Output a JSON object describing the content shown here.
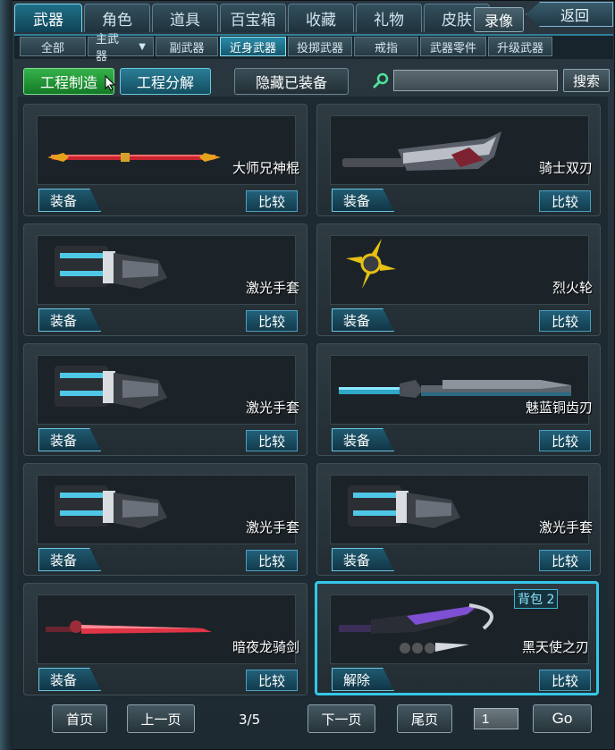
{
  "top_tabs": [
    "武器",
    "角色",
    "道具",
    "百宝箱",
    "收藏",
    "礼物",
    "皮肤"
  ],
  "video_label": "录像",
  "back_label": "返回",
  "sub_tabs": {
    "all": "全部",
    "primary": "主武器",
    "secondary": "副武器",
    "melee": "近身武器",
    "throwing": "投掷武器",
    "ring": "戒指",
    "parts": "武器零件",
    "upgrade": "升级武器"
  },
  "actions": {
    "craft": "工程制造",
    "disassemble": "工程分解",
    "hide_equipped": "隐藏已装备",
    "search_value": "",
    "search_button": "搜索"
  },
  "items": [
    {
      "name": "大师兄神棍",
      "action": "装备",
      "compare": "比较",
      "icon": "staff-icon"
    },
    {
      "name": "骑士双刃",
      "action": "装备",
      "compare": "比较",
      "icon": "dual-blade-icon"
    },
    {
      "name": "激光手套",
      "action": "装备",
      "compare": "比较",
      "icon": "laser-glove-icon"
    },
    {
      "name": "烈火轮",
      "action": "装备",
      "compare": "比较",
      "icon": "fire-wheel-icon"
    },
    {
      "name": "激光手套",
      "action": "装备",
      "compare": "比较",
      "icon": "laser-glove-icon"
    },
    {
      "name": "魅蓝铜齿刃",
      "action": "装备",
      "compare": "比较",
      "icon": "saw-blade-icon"
    },
    {
      "name": "激光手套",
      "action": "装备",
      "compare": "比较",
      "icon": "laser-glove-icon"
    },
    {
      "name": "激光手套",
      "action": "装备",
      "compare": "比较",
      "icon": "laser-glove-icon"
    },
    {
      "name": "暗夜龙骑剑",
      "action": "装备",
      "compare": "比较",
      "icon": "sword-icon"
    },
    {
      "name": "黑天使之刃",
      "action": "解除",
      "compare": "比较",
      "badge": "背包 2",
      "icon": "black-angel-blade-icon"
    }
  ],
  "pager": {
    "first": "首页",
    "prev": "上一页",
    "page": "3/5",
    "next": "下一页",
    "last": "尾页",
    "jump_value": "1",
    "go": "Go"
  }
}
